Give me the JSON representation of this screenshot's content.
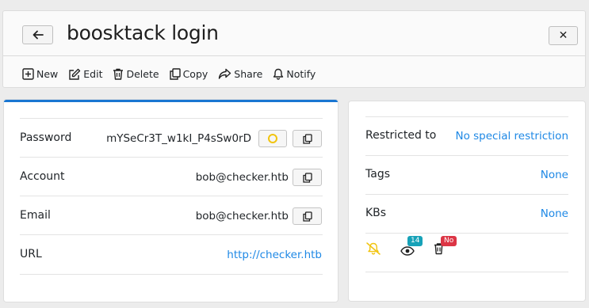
{
  "header": {
    "title": "boosktack login"
  },
  "toolbar": {
    "items": [
      {
        "label": "New",
        "icon": "plus-square-icon"
      },
      {
        "label": "Edit",
        "icon": "edit-icon"
      },
      {
        "label": "Delete",
        "icon": "trash-icon"
      },
      {
        "label": "Copy",
        "icon": "copy-icon"
      },
      {
        "label": "Share",
        "icon": "share-icon"
      },
      {
        "label": "Notify",
        "icon": "bell-icon"
      }
    ]
  },
  "details": {
    "password": {
      "label": "Password",
      "value": "mYSeCr3T_w1kI_P4sSw0rD"
    },
    "account": {
      "label": "Account",
      "value": "bob@checker.htb"
    },
    "email": {
      "label": "Email",
      "value": "bob@checker.htb"
    },
    "url": {
      "label": "URL",
      "value": "http://checker.htb"
    }
  },
  "meta": {
    "restricted": {
      "label": "Restricted to",
      "value": "No special restriction"
    },
    "tags": {
      "label": "Tags",
      "value": "None"
    },
    "kbs": {
      "label": "KBs",
      "value": "None"
    }
  },
  "status": {
    "views_badge": "14",
    "delete_badge": "No"
  },
  "colors": {
    "accent": "#1976d2",
    "link": "#1e88e5",
    "bell_off": "#f1c40f",
    "views_badge": "#17a2b8",
    "delete_badge": "#dc3545"
  }
}
